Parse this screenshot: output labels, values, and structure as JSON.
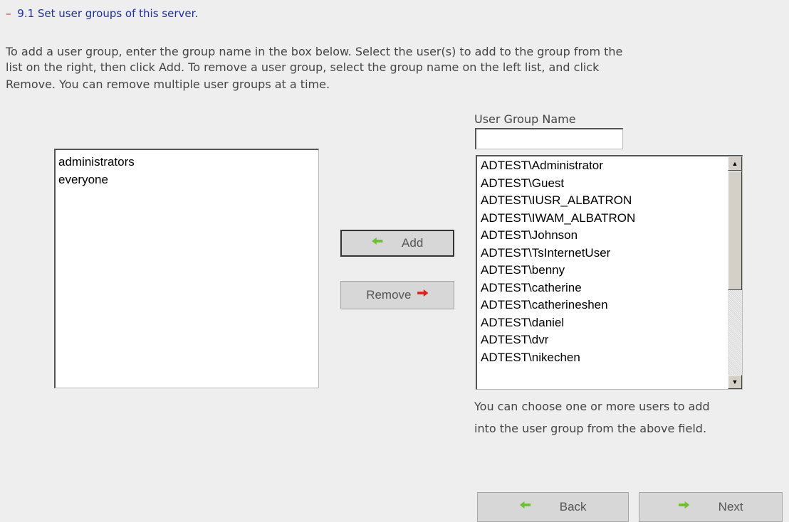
{
  "section": {
    "dash": "–",
    "title": "9.1 Set user groups of this server."
  },
  "description": {
    "line1": "To add a user group, enter the group name in the box below. Select the user(s) to add to the group from the",
    "line2": "list on the right, then click Add. To remove a user group, select the group name on the left list, and click",
    "line3": "Remove. You can remove multiple user groups at a time."
  },
  "group_list": {
    "items": [
      "administrators",
      "everyone"
    ]
  },
  "group_name": {
    "label": "User Group Name",
    "value": ""
  },
  "user_list": {
    "items": [
      "ADTEST\\Administrator",
      "ADTEST\\Guest",
      "ADTEST\\IUSR_ALBATRON",
      "ADTEST\\IWAM_ALBATRON",
      "ADTEST\\Johnson",
      "ADTEST\\TsInternetUser",
      "ADTEST\\benny",
      "ADTEST\\catherine",
      "ADTEST\\catherineshen",
      "ADTEST\\daniel",
      "ADTEST\\dvr",
      "ADTEST\\nikechen"
    ]
  },
  "buttons": {
    "add": "Add",
    "remove": "Remove",
    "back": "Back",
    "next": "Next"
  },
  "hint": {
    "line1": "You can choose one or more users to add",
    "line2": "into the user group from the above field."
  },
  "colors": {
    "title": "#1f2fa8",
    "dash": "#cc2222",
    "arrow_green": "#6cc22c",
    "arrow_red": "#e02020"
  },
  "icons": {
    "add": "arrow-left-green-icon",
    "remove": "arrow-right-red-icon",
    "back": "arrow-left-green-icon",
    "next": "arrow-right-green-icon"
  }
}
